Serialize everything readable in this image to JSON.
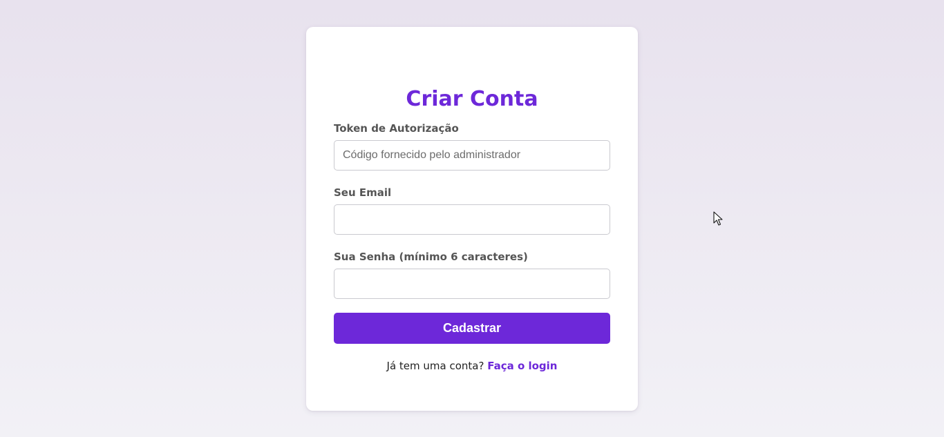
{
  "form": {
    "title": "Criar Conta",
    "fields": [
      {
        "label": "Token de Autorização",
        "value": "",
        "placeholder": "Código fornecido pelo administrador"
      },
      {
        "label": "Seu Email",
        "value": "",
        "placeholder": ""
      },
      {
        "label": "Sua Senha (mínimo 6 caracteres)",
        "value": "",
        "placeholder": ""
      }
    ],
    "submit_label": "Cadastrar",
    "footer_text": "Já tem uma conta?",
    "footer_link": "Faça o login"
  },
  "colors": {
    "accent": "#6d28d9",
    "label": "#555555",
    "background_top": "#e8e2ee",
    "background_bottom": "#f2f1f6"
  },
  "icons": {
    "cursor": "mouse-pointer-icon"
  }
}
